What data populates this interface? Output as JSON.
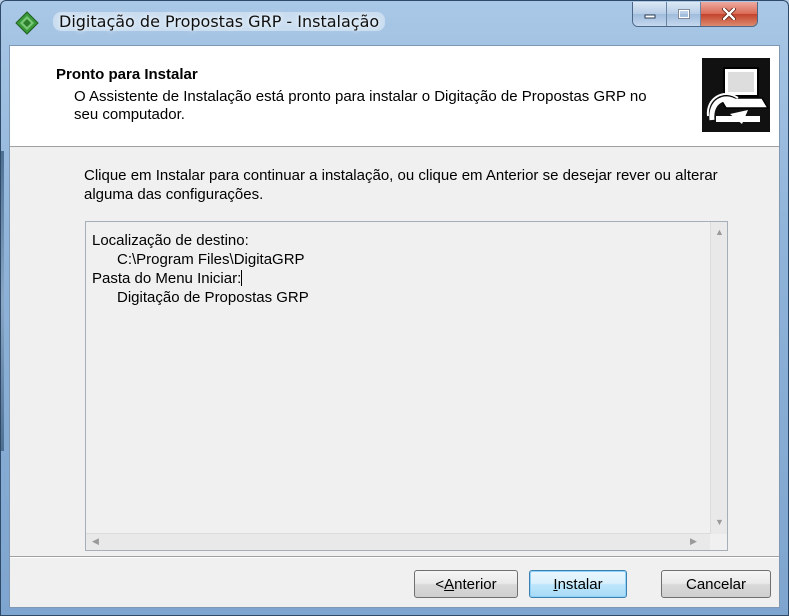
{
  "window": {
    "title": "Digitação de Propostas GRP - Instalação",
    "icons": {
      "app": "green-diamond-icon",
      "minimize": "minimize-icon",
      "maximize": "maximize-icon",
      "close": "close-icon"
    }
  },
  "header": {
    "title": "Pronto para Instalar",
    "description": "O Assistente de Instalação está pronto para instalar o Digitação de Propostas GRP no seu computador.",
    "logo_icon": "computer-install-icon"
  },
  "instruction": "Clique em Instalar para continuar a instalação, ou clique em Anterior se desejar rever ou alterar alguma das configurações.",
  "summary": {
    "lines": [
      "Localização de destino:",
      "      C:\\Program Files\\DigitaGRP",
      "",
      "Pasta do Menu Iniciar:",
      "      Digitação de Propostas GRP"
    ]
  },
  "buttons": {
    "previous": {
      "prefix": "< ",
      "accel": "A",
      "rest": "nterior"
    },
    "install": {
      "prefix": "",
      "accel": "I",
      "rest": "nstalar"
    },
    "cancel": {
      "label": "Cancelar"
    }
  },
  "colors": {
    "title_gradient": "#8fb3d9",
    "close_button": "#c3432d",
    "default_button_border": "#3c7fb1",
    "app_icon": "#3a9a3a"
  }
}
